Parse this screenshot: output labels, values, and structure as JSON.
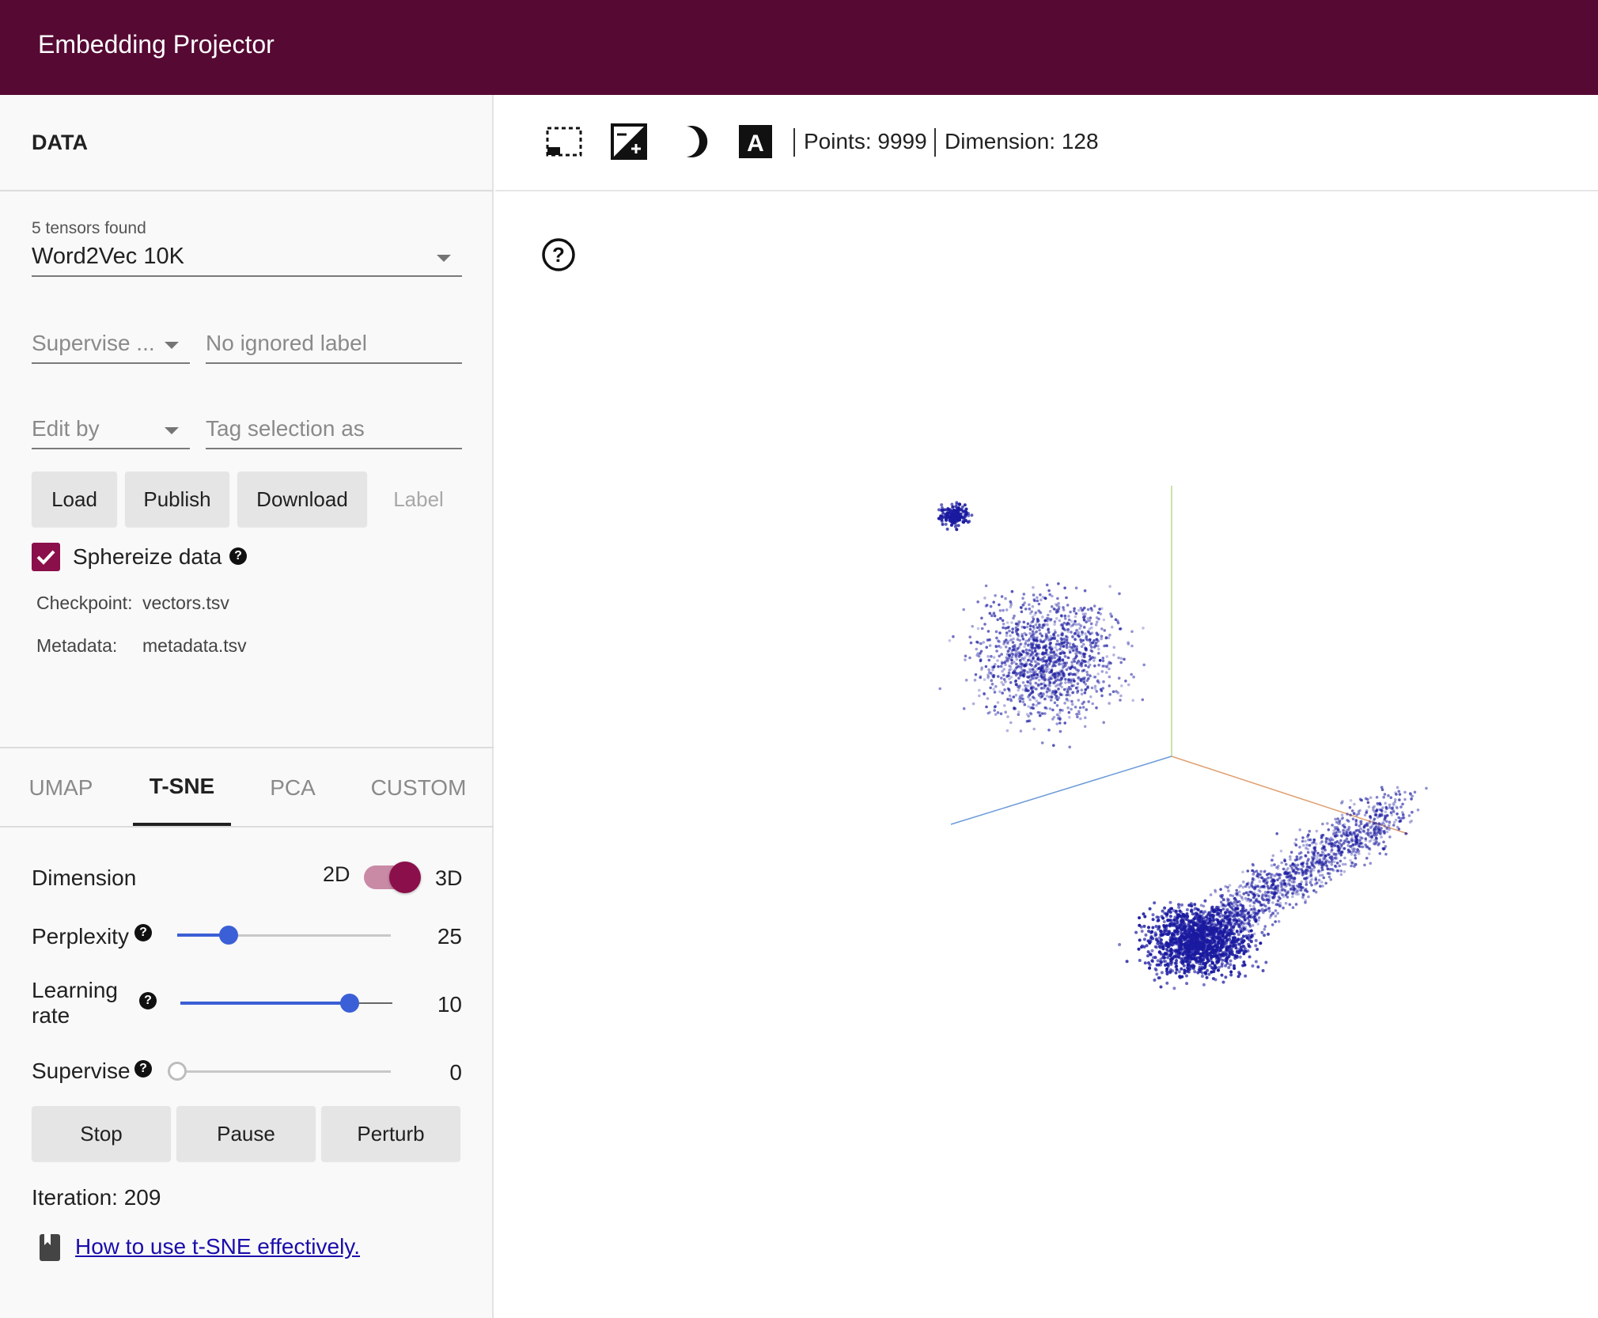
{
  "app": {
    "title": "Embedding Projector"
  },
  "data_panel": {
    "header": "DATA",
    "tensors_found": "5 tensors found",
    "tensor_selected": "Word2Vec 10K",
    "supervise_select_placeholder": "Supervise ...",
    "ignored_label_placeholder": "No ignored label",
    "edit_by_placeholder": "Edit by",
    "tag_selection_placeholder": "Tag selection as",
    "buttons": {
      "load": "Load",
      "publish": "Publish",
      "download": "Download",
      "label": "Label"
    },
    "sphereize": {
      "label": "Sphereize data",
      "checked": true
    },
    "checkpoint": {
      "label": "Checkpoint:",
      "value": "vectors.tsv"
    },
    "metadata": {
      "label": "Metadata:",
      "value": "metadata.tsv"
    }
  },
  "projection_tabs": [
    {
      "label": "UMAP",
      "active": false
    },
    {
      "label": "T-SNE",
      "active": true
    },
    {
      "label": "PCA",
      "active": false
    },
    {
      "label": "CUSTOM",
      "active": false
    }
  ],
  "tsne": {
    "dimension": {
      "label": "Dimension",
      "left": "2D",
      "right": "3D",
      "value": "3D"
    },
    "perplexity": {
      "label": "Perplexity",
      "value": "25",
      "fraction": 0.24
    },
    "learning_rate": {
      "label_line1": "Learning",
      "label_line2": "rate",
      "value": "10",
      "fraction": 0.8
    },
    "supervise": {
      "label": "Supervise",
      "value": "0",
      "fraction": 0.0
    },
    "buttons": {
      "stop": "Stop",
      "pause": "Pause",
      "perturb": "Perturb"
    },
    "iteration": "Iteration: 209",
    "help_link": "How to use t-SNE effectively."
  },
  "toolbar": {
    "icons": [
      "selection-box-icon",
      "night-mode-icon",
      "moon-icon",
      "label-a-icon"
    ],
    "points": "Points: 9999",
    "dimension": "Dimension: 128"
  },
  "colors": {
    "brand": "#560933",
    "accent": "#8b0f4a",
    "slider": "#3b5fd6",
    "points": "#1a1aa0"
  }
}
